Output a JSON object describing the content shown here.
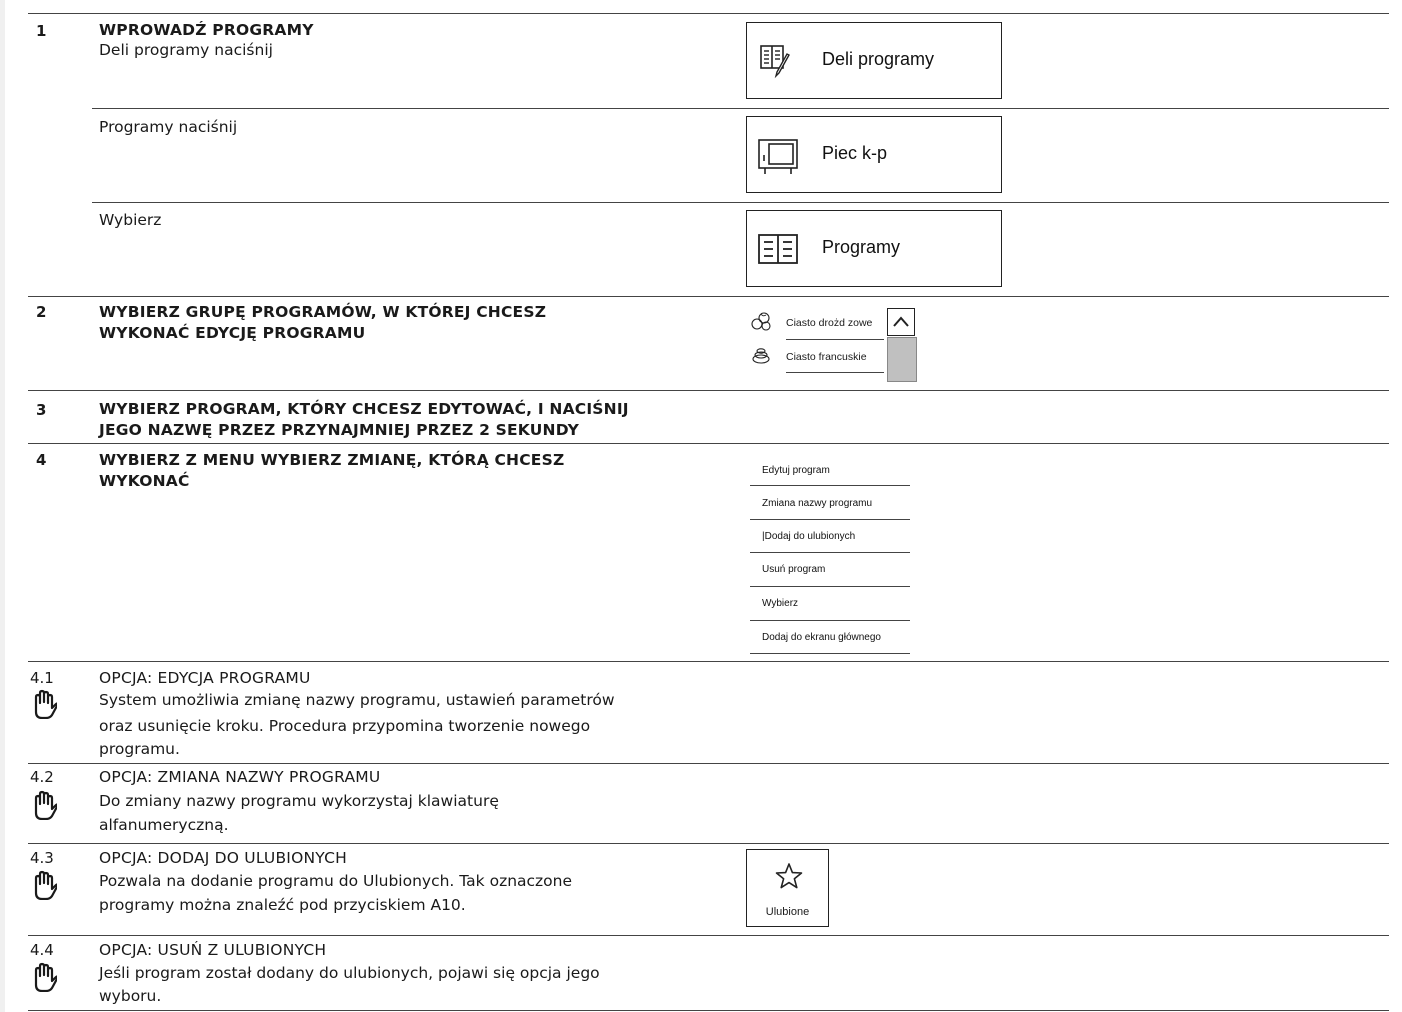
{
  "steps": {
    "s1": {
      "num": "1",
      "title": "WPROWADŹ PROGRAMY",
      "sub_a": "Deli programy naciśnij",
      "sub_b": "Programy naciśnij",
      "sub_c": "Wybierz"
    },
    "s2": {
      "num": "2",
      "title_line1": "WYBIERZ GRUPĘ PROGRAMÓW, W KTÓREJ CHCESZ",
      "title_line2": "WYKONAĆ EDYCJĘ PROGRAMU"
    },
    "s3": {
      "num": "3",
      "title_line1": "WYBIERZ PROGRAM, KTÓRY CHCESZ EDYTOWAĆ, I NACIŚNIJ",
      "title_line2": "JEGO NAZWĘ PRZEZ PRZYNAJMNIEJ PRZEZ 2 SEKUNDY"
    },
    "s4": {
      "num": "4",
      "title_line1": "WYBIERZ Z MENU WYBIERZ ZMIANĘ, KTÓRĄ CHCESZ",
      "title_line2": "WYKONAĆ"
    }
  },
  "options": [
    {
      "num": "4.1",
      "title": "OPCJA: EDYCJA PROGRAMU",
      "lines": [
        "System umożliwia zmianę nazwy programu, ustawień parametrów",
        "oraz usunięcie kroku. Procedura przypomina tworzenie nowego",
        "programu."
      ]
    },
    {
      "num": "4.2",
      "title": "OPCJA: ZMIANA NAZWY PROGRAMU",
      "lines": [
        "Do zmiany nazwy programu wykorzystaj klawiaturę",
        "alfanumeryczną."
      ]
    },
    {
      "num": "4.3",
      "title": "OPCJA: DODAJ DO ULUBIONYCH",
      "lines": [
        "Pozwala na dodanie programu do Ulubionych. Tak oznaczone",
        "programy można znaleźć pod przyciskiem A10."
      ]
    },
    {
      "num": "4.4",
      "title": "OPCJA: USUŃ Z ULUBIONYCH",
      "lines": [
        "Jeśli program został dodany do ulubionych, pojawi się opcja jego",
        "wyboru."
      ]
    }
  ],
  "buttons": {
    "deli": "Deli programy",
    "piec": "Piec k-p",
    "programy": "Programy",
    "ulubione": "Ulubione"
  },
  "group_list": {
    "items": [
      "Ciasto drożd zowe",
      "Ciasto francuskie"
    ]
  },
  "menu": {
    "items": [
      "Edytuj program",
      "Zmiana nazwy programu",
      "|Dodaj do ulubionych",
      "Usuń program",
      "Wybierz",
      "Dodaj do ekranu głównego"
    ]
  },
  "icons": {
    "hand": "hand-stop-icon",
    "deli": "recipe-book-pencil-icon",
    "oven": "combi-oven-icon",
    "programs": "program-list-icon",
    "dough": "bread-dough-icon",
    "pastry": "puff-pastry-icon",
    "chevron": "chevron-up-icon",
    "star": "star-icon"
  }
}
